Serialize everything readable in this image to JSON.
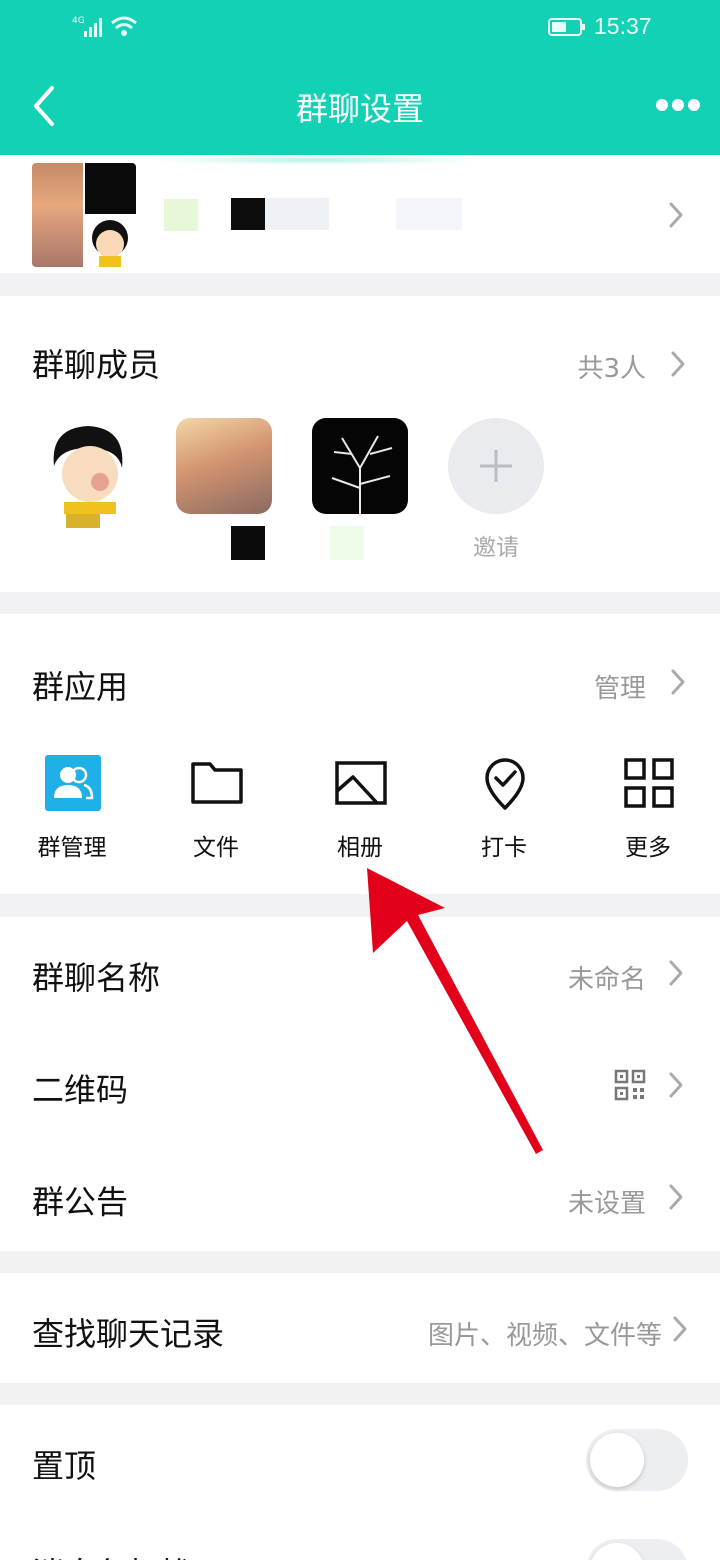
{
  "status_bar": {
    "network": "4G",
    "time": "15:37"
  },
  "header": {
    "title": "群聊设置",
    "back_icon": "chevron-left-icon",
    "more_icon": "more-dots-icon"
  },
  "members": {
    "title": "群聊成员",
    "count_label": "共3人",
    "invite_label": "邀请"
  },
  "apps": {
    "title": "群应用",
    "manage_label": "管理",
    "items": [
      {
        "label": "群管理",
        "icon": "group-manage-icon"
      },
      {
        "label": "文件",
        "icon": "folder-icon"
      },
      {
        "label": "相册",
        "icon": "album-icon"
      },
      {
        "label": "打卡",
        "icon": "checkin-icon"
      },
      {
        "label": "更多",
        "icon": "grid-icon"
      }
    ]
  },
  "settings": {
    "group_name": {
      "label": "群聊名称",
      "value": "未命名"
    },
    "qr_code": {
      "label": "二维码",
      "icon": "qr-code-icon"
    },
    "announcement": {
      "label": "群公告",
      "value": "未设置"
    }
  },
  "search": {
    "label": "查找聊天记录",
    "hint": "图片、视频、文件等"
  },
  "toggles": [
    {
      "label": "置顶",
      "on": false
    },
    {
      "label": "消息免打扰",
      "on": false
    }
  ],
  "colors": {
    "header": "#12d1b4",
    "annotation_arrow": "#e3001b",
    "app_accent": "#1fb0e8"
  }
}
